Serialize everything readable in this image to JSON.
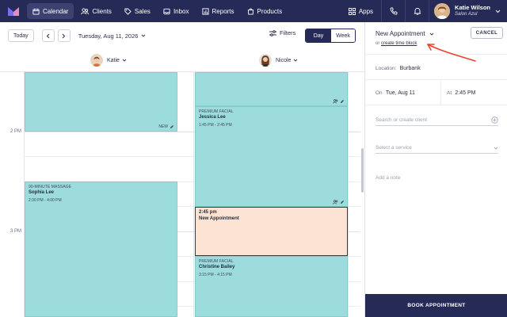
{
  "nav": {
    "items": [
      {
        "label": "Calendar",
        "icon": "calendar-icon",
        "active": true
      },
      {
        "label": "Clients",
        "icon": "clients-icon"
      },
      {
        "label": "Sales",
        "icon": "tag-icon"
      },
      {
        "label": "Inbox",
        "icon": "inbox-icon"
      },
      {
        "label": "Reports",
        "icon": "bar-chart-icon"
      },
      {
        "label": "Products",
        "icon": "bag-icon"
      }
    ],
    "apps_label": "Apps",
    "user": {
      "name": "Katie Wilson",
      "salon": "Salon Azul"
    }
  },
  "toolbar": {
    "today_label": "Today",
    "date_label": "Tuesday, Aug 11, 2026",
    "filters_label": "Filters",
    "view_day": "Day",
    "view_week": "Week",
    "active_view": "Day"
  },
  "staff": [
    {
      "name": "Katie"
    },
    {
      "name": "Nicole"
    }
  ],
  "time_labels": [
    "2 PM",
    "3 PM"
  ],
  "appointments": {
    "katie_top": {
      "corner_label": "NEW"
    },
    "katie_massage": {
      "service": "90-MINUTE MASSAGE",
      "client": "Sophia Lee",
      "time": "2:30 PM - 4:00 PM"
    },
    "nicole_facial_1": {
      "service": "PREMIUM FACIAL",
      "client": "Jessica Lee",
      "time": "1:45 PM - 2:45 PM"
    },
    "new": {
      "time": "2:45 pm",
      "title": "New Appointment"
    },
    "nicole_facial_2": {
      "service": "PREMIUM FACIAL",
      "client": "Christine Bailey",
      "time": "3:15 PM - 4:15 PM"
    }
  },
  "panel": {
    "title": "New Appointment",
    "sub_prefix": "or",
    "sub_link": "create time block",
    "cancel_label": "CANCEL",
    "location_label": "Location:",
    "location_value": "Burbank",
    "on_label": "On",
    "on_value": "Tue, Aug 11",
    "at_label": "At",
    "at_value": "2:45 PM",
    "client_placeholder": "Search or create client",
    "service_placeholder": "Select a service",
    "note_placeholder": "Add a note",
    "book_label": "BOOK APPOINTMENT"
  },
  "colors": {
    "nav_bg": "#262a56",
    "appointment_teal": "#9ddcdc",
    "new_appointment": "#fde3d3",
    "annotation_red": "#e8452c"
  }
}
